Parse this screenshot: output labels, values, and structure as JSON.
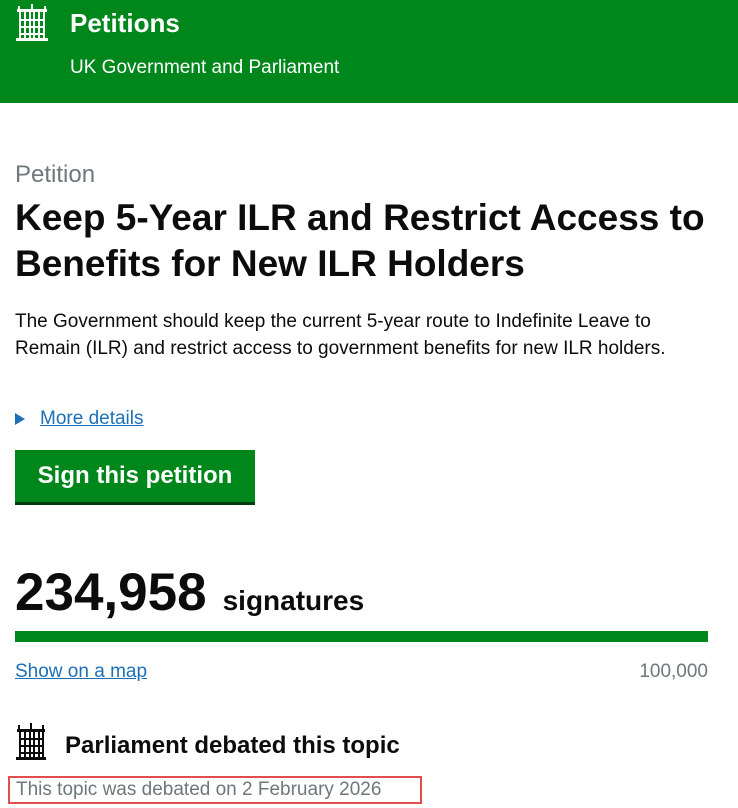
{
  "header": {
    "site_title": "Petitions",
    "site_subtitle": "UK Government and Parliament",
    "logo_icon": "portcullis-icon",
    "background_color": "#00871b"
  },
  "petition": {
    "caption": "Petition",
    "title": "Keep 5-Year ILR and Restrict Access to Benefits for New ILR Holders",
    "description": "The Government should keep the current 5-year route to Indefinite Leave to Remain (ILR) and restrict access to government benefits for new ILR holders.",
    "more_details_label": "More details",
    "sign_button_label": "Sign this petition"
  },
  "signatures": {
    "count": "234,958",
    "label": "signatures",
    "progress_fraction": 1.0,
    "map_link_label": "Show on a map",
    "threshold": "100,000"
  },
  "debate": {
    "icon": "portcullis-icon",
    "heading": "Parliament debated this topic",
    "date_text": "This topic was debated on 2 February 2026"
  },
  "colors": {
    "brand_green": "#00871b",
    "link_blue": "#1d70b8",
    "secondary_text": "#6f777b",
    "highlight_red": "#e24e4e"
  }
}
